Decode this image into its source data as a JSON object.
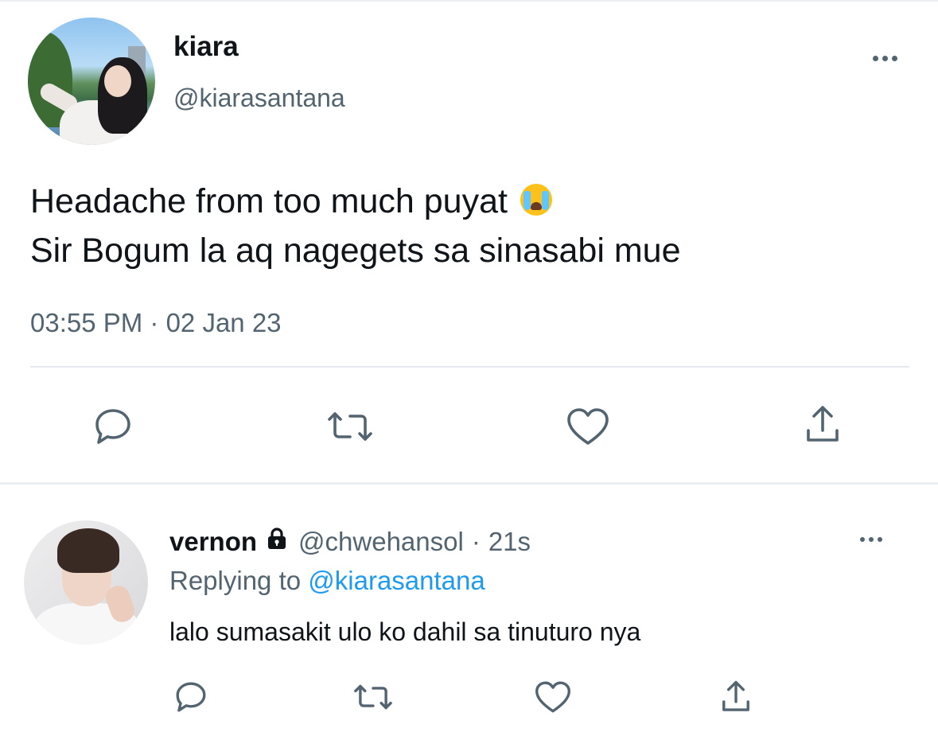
{
  "main_tweet": {
    "display_name": "kiara",
    "handle": "@kiarasantana",
    "text_line_1": "Headache from too much puyat",
    "text_line_2": "Sir Bogum la aq nagegets sa sinasabi mue",
    "emoji": "loudly-crying-face",
    "timestamp": "03:55 PM · 02 Jan 23",
    "actions": [
      "reply-icon",
      "retweet-icon",
      "like-icon",
      "share-icon"
    ]
  },
  "reply": {
    "display_name": "vernon",
    "lock": "lock-icon",
    "handle": "@chwehansol",
    "separator": "·",
    "time": "21s",
    "replying_prefix": "Replying to",
    "replying_to": "@kiarasantana",
    "text": "lalo sumasakit ulo ko dahil sa tinuturo nya",
    "actions": [
      "reply-icon",
      "retweet-icon",
      "like-icon",
      "share-icon"
    ]
  },
  "colors": {
    "primary_text": "#0f1419",
    "secondary_text": "#536471",
    "link": "#1d9bf0",
    "divider": "#e6e9eb"
  }
}
